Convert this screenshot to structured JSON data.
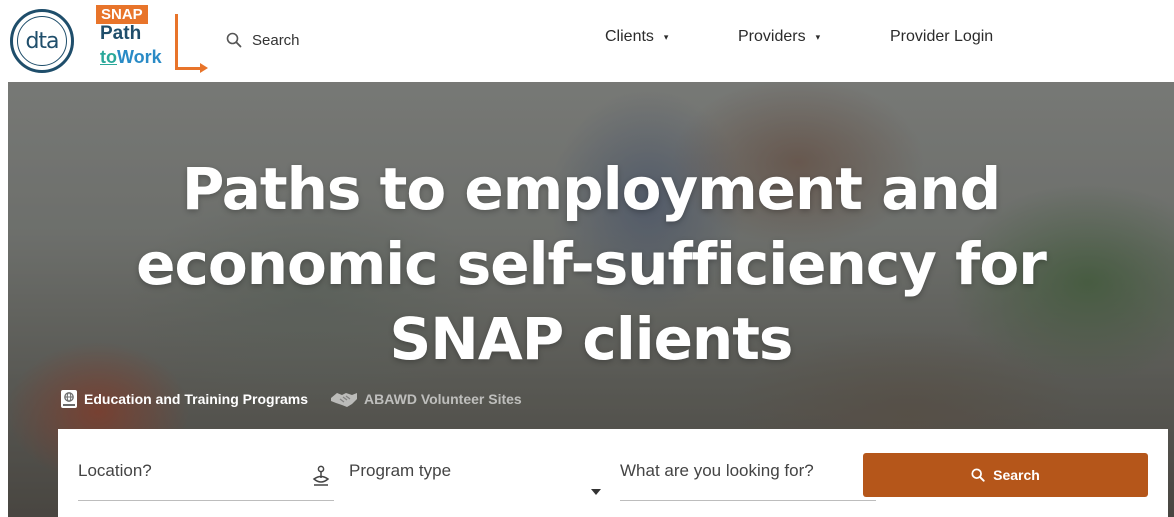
{
  "header": {
    "dta_logo_text": "dta",
    "snap_logo": {
      "badge": "SNAP",
      "line1": "Path",
      "line2_to": "to",
      "line2_work": "Work"
    },
    "search_label": "Search",
    "nav": [
      {
        "label": "Clients",
        "has_dropdown": true
      },
      {
        "label": "Providers",
        "has_dropdown": true
      },
      {
        "label": "Provider Login",
        "has_dropdown": false
      }
    ],
    "caret": "▾"
  },
  "hero": {
    "title_line1": "Paths to employment and",
    "title_line2": "economic self-sufficiency for",
    "title_line3": "SNAP clients",
    "links": [
      {
        "label": "Education and Training Programs",
        "icon": "book-icon",
        "active": true
      },
      {
        "label": "ABAWD Volunteer Sites",
        "icon": "handshake-icon",
        "active": false
      }
    ]
  },
  "search_panel": {
    "location_placeholder": "Location?",
    "location_icon": "location-pin-icon",
    "program_type_placeholder": "Program type",
    "query_placeholder": "What are you looking for?",
    "search_button_label": "Search"
  },
  "colors": {
    "brand_navy": "#1f4e6b",
    "snap_orange": "#e8742a",
    "search_button": "#b5561a"
  }
}
